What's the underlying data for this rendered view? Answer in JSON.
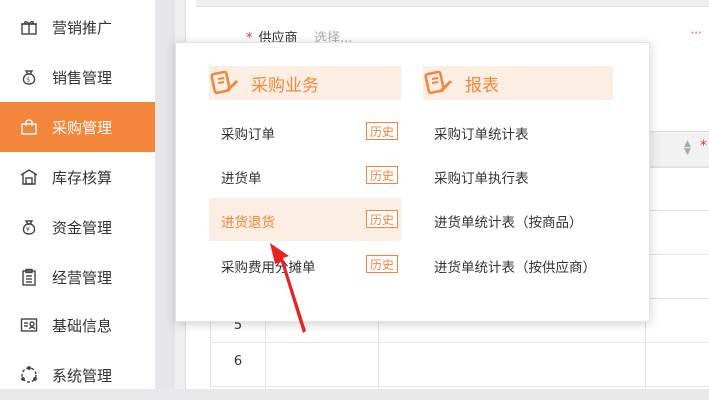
{
  "sidebar": {
    "items": [
      {
        "label": "营销推广",
        "icon": "gift-icon",
        "active": false
      },
      {
        "label": "销售管理",
        "icon": "money-bag-icon",
        "active": false
      },
      {
        "label": "采购管理",
        "icon": "shopping-bag-icon",
        "active": true
      },
      {
        "label": "库存核算",
        "icon": "warehouse-icon",
        "active": false
      },
      {
        "label": "资金管理",
        "icon": "yen-bag-icon",
        "active": false
      },
      {
        "label": "经营管理",
        "icon": "clipboard-icon",
        "active": false
      },
      {
        "label": "基础信息",
        "icon": "id-card-icon",
        "active": false
      },
      {
        "label": "系统管理",
        "icon": "settings-circle-icon",
        "active": false
      }
    ]
  },
  "form": {
    "supplier_label": "供应商",
    "required_mark": "*",
    "supplier_placeholder": "选择...",
    "more": "···"
  },
  "table": {
    "header_required_mark": "*",
    "row_numbers": [
      "5",
      "6"
    ]
  },
  "popover": {
    "purchase": {
      "title": "采购业务",
      "icon": "document-pen-icon",
      "items": [
        {
          "label": "采购订单",
          "history": "历史",
          "highlighted": false
        },
        {
          "label": "进货单",
          "history": "历史",
          "highlighted": false
        },
        {
          "label": "进货退货",
          "history": "历史",
          "highlighted": true
        },
        {
          "label": "采购费用分摊单",
          "history": "历史",
          "highlighted": false
        }
      ]
    },
    "report": {
      "title": "报表",
      "icon": "report-pen-icon",
      "items": [
        {
          "label": "采购订单统计表"
        },
        {
          "label": "采购订单执行表"
        },
        {
          "label": "进货单统计表（按商品）"
        },
        {
          "label": "进货单统计表（按供应商）"
        }
      ]
    }
  },
  "colors": {
    "accent": "#f4863c",
    "accent_light": "#fdeee3",
    "required": "#e23b2e",
    "annotation_arrow": "#e8231f"
  }
}
